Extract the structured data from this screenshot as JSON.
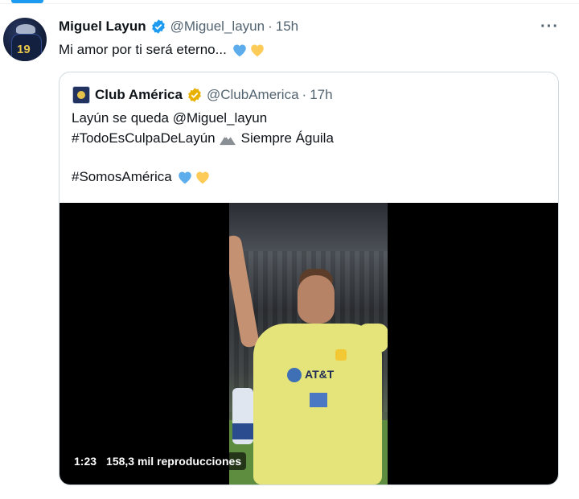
{
  "tweet": {
    "author_name": "Miguel Layun",
    "author_handle": "@Miguel_layun",
    "separator": "·",
    "time": "15h",
    "text": "Mi amor por ti será eterno...",
    "more_label": "···"
  },
  "quoted_tweet": {
    "author_name": "Club América",
    "author_handle": "@ClubAmerica",
    "separator": "·",
    "time": "17h",
    "line1": "Layún se queda @Miguel_layun",
    "line2_hashtag": "#TodoEsCulpaDeLayún",
    "line2_rest": "Siempre Águila",
    "line3": "#SomosAmérica"
  },
  "video": {
    "duration": "1:23",
    "views": "158,3 mil reproducciones"
  },
  "colors": {
    "verified_blue": "#1d9bf0",
    "verified_gold": "#e8b100",
    "heart_blue": "#5dadec",
    "heart_yellow": "#fdcb58"
  },
  "icons": [
    "verified-badge-icon",
    "gold-verified-badge-icon",
    "blue-heart-icon",
    "yellow-heart-icon",
    "mountain-icon",
    "more-icon"
  ]
}
